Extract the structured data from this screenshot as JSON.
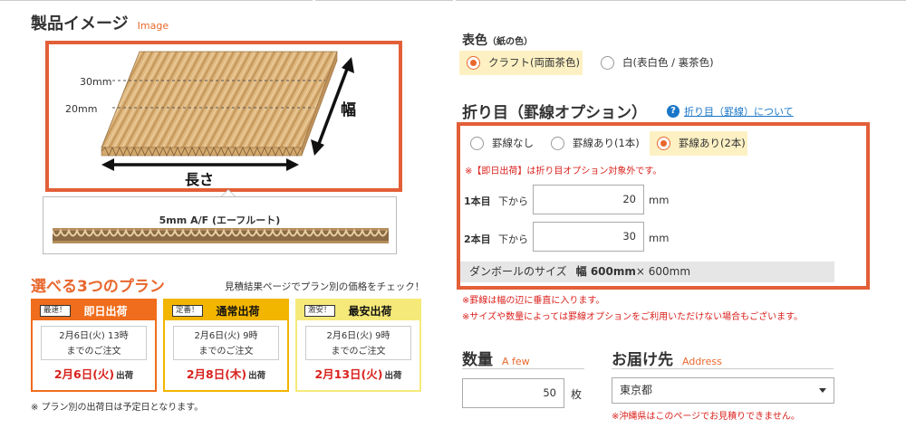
{
  "product_image": {
    "title": "製品イメージ",
    "title_en": "Image",
    "label_30mm": "30mm",
    "label_20mm": "20mm",
    "label_width": "幅",
    "label_length": "長さ",
    "flute_label": "5mm A/F (エーフルート)"
  },
  "plans": {
    "title": "選べる3つのプラン",
    "note": "見積結果ページでプラン別の価格をチェック！",
    "items": [
      {
        "badge": "最速！",
        "name": "即日出荷",
        "line1": "2月6日(火) 13時",
        "line2": "までのご注文",
        "date": "2月6日(火)",
        "suffix": "出荷",
        "color": "#ef6d1c",
        "header_text_color": "#ffffff"
      },
      {
        "badge": "定番！",
        "name": "通常出荷",
        "line1": "2月6日(火) 9時",
        "line2": "までのご注文",
        "date": "2月8日(木)",
        "suffix": "出荷",
        "color": "#f2b500",
        "header_text_color": "#111111"
      },
      {
        "badge": "激安！",
        "name": "最安出荷",
        "line1": "2月6日(火) 9時",
        "line2": "までのご注文",
        "date": "2月13日(火)",
        "suffix": "出荷",
        "color": "#f5e979",
        "header_text_color": "#111111"
      }
    ],
    "footnote": "※ プラン別の出荷日は予定日となります。"
  },
  "color_section": {
    "title": "表色",
    "title_note": "（紙の色）",
    "options": [
      {
        "label": "クラフト(両面茶色)",
        "selected": true
      },
      {
        "label": "白(表白色 / 裏茶色)",
        "selected": false
      }
    ]
  },
  "fold_section": {
    "title": "折り目（罫線オプション）",
    "help_link": "折り目（罫線）について",
    "options": [
      {
        "label": "罫線なし",
        "selected": false
      },
      {
        "label": "罫線あり(1本)",
        "selected": false
      },
      {
        "label": "罫線あり(2本)",
        "selected": true
      }
    ],
    "warning": "※【即日出荷】は折り目オプション対象外です。",
    "rows": [
      {
        "label": "1本目",
        "sub": "下から",
        "value": "20",
        "unit": "mm"
      },
      {
        "label": "2本目",
        "sub": "下から",
        "value": "30",
        "unit": "mm"
      }
    ],
    "size_label": "ダンボールのサイズ",
    "size_width": "幅 600mm",
    "size_rest": "× 600mm",
    "notes": [
      "※罫線は幅の辺に垂直に入ります。",
      "※サイズや数量によっては罫線オプションをご利用いただけない場合もございます。"
    ]
  },
  "quantity": {
    "title": "数量",
    "title_en": "A few",
    "value": "50",
    "unit": "枚"
  },
  "destination": {
    "title": "お届け先",
    "title_en": "Address",
    "selected": "東京都",
    "note": "※沖縄県はこのページでお見積りできません。"
  },
  "colors": {
    "accent": "#e8672d",
    "frame": "#e25f37",
    "error": "#d9211d",
    "link": "#1a76c8"
  }
}
